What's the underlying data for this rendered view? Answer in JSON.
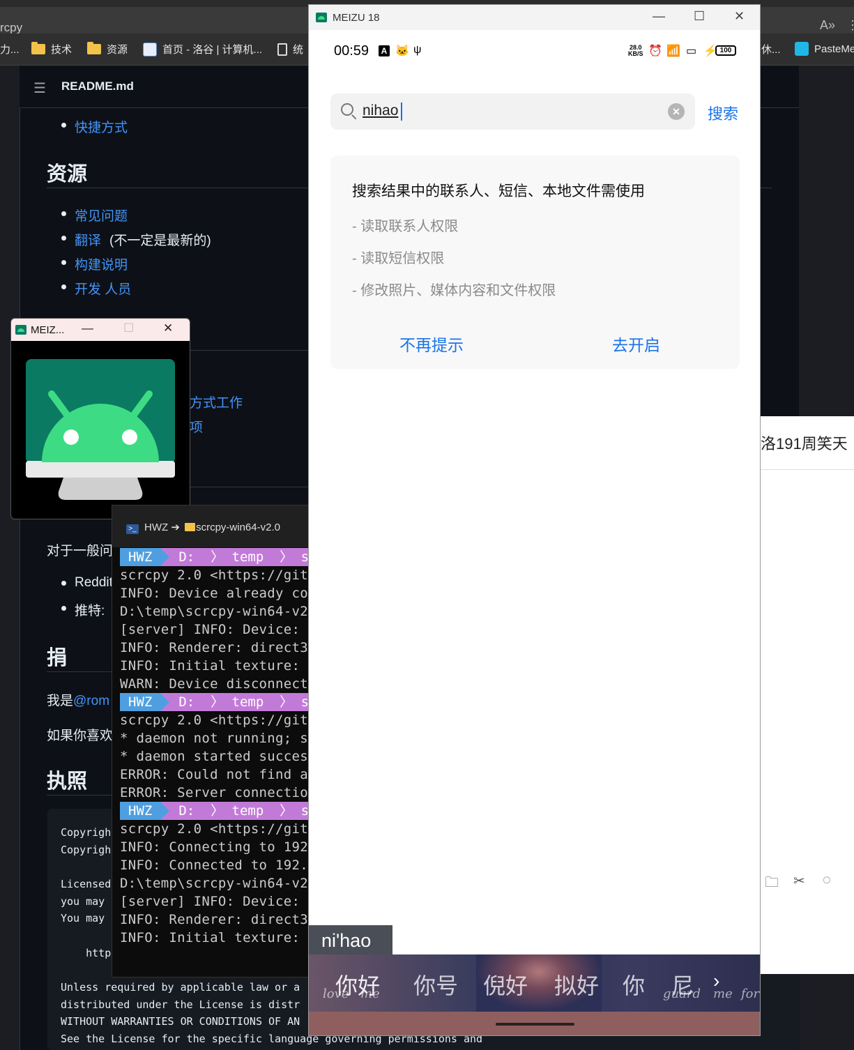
{
  "browser": {
    "title_fragment": "rcpy",
    "bookmarks": [
      {
        "label": "力..."
      },
      {
        "label": "技术"
      },
      {
        "label": "资源"
      },
      {
        "label": "首页 - 洛谷 | 计算机..."
      },
      {
        "label": "统"
      },
      {
        "label": "休..."
      },
      {
        "label": "PasteMe"
      }
    ]
  },
  "readme": {
    "title": "README.md",
    "top_link": "快捷方式",
    "resources_heading": "资源",
    "resource_links": [
      "常见问题",
      "翻译",
      "构建说明",
      "开发 人员"
    ],
    "translation_note": "(不一定是最新的)",
    "partial_link_1": "方式工作",
    "partial_link_2": "项",
    "general_prefix": "对于一般问",
    "bullet_reddit": "Reddit",
    "bullet_twitter": "推特:",
    "donate_heading": "捐",
    "i_am": "我是",
    "author_link": "@rom",
    "if_you_like": "如果你喜欢",
    "license_heading": "执照",
    "code_lines": [
      "Copyrigh",
      "Copyrigh",
      "",
      "Licensed",
      "you may",
      "You may",
      "",
      "    http"
    ],
    "license_tail": [
      "Unless required by applicable law or a",
      "distributed under the License is distr",
      "WITHOUT WARRANTIES OR CONDITIONS OF AN",
      "See the License for the specific language governing permissions and"
    ]
  },
  "right_window": {
    "title": "洛191周笑天"
  },
  "small_window": {
    "title": "MEIZ..."
  },
  "terminal": {
    "tab_label_user": "HWZ",
    "tab_label_arrow": "➔",
    "tab_label_dir": "scrcpy-win64-v2.0",
    "prompt_user": "HWZ",
    "prompt_path": "D:  〉 temp  〉 scr",
    "block1": [
      "scrcpy 2.0 <https://git",
      "INFO: Device already co",
      "D:\\temp\\scrcpy-win64-v2",
      "[server] INFO: Device: ",
      "INFO: Renderer: direct3",
      "INFO: Initial texture: ",
      "WARN: Device disconnect"
    ],
    "block2": [
      "scrcpy 2.0 <https://git",
      "* daemon not running; s",
      "* daemon started succes",
      "ERROR: Could not find a",
      "ERROR: Server connectio"
    ],
    "block3": [
      "scrcpy 2.0 <https://git",
      "INFO: Connecting to 192",
      "INFO: Connected to 192.",
      "D:\\temp\\scrcpy-win64-v2",
      "[server] INFO: Device: ",
      "INFO: Renderer: direct3",
      "INFO: Initial texture: "
    ]
  },
  "phone": {
    "window_title": "MEIZU 18",
    "status": {
      "time": "00:59",
      "net_speed_value": "28.0",
      "net_speed_unit": "KB/S",
      "battery": "100"
    },
    "search": {
      "query": "nihao",
      "action": "搜索"
    },
    "permission_card": {
      "title": "搜索结果中的联系人、短信、本地文件需使用",
      "items": [
        "- 读取联系人权限",
        "- 读取短信权限",
        "- 修改照片、媒体内容和文件权限"
      ],
      "dismiss": "不再提示",
      "enable": "去开启"
    },
    "ime": {
      "composition": "ni'hao",
      "candidates": [
        "你好",
        "你号",
        "倪好",
        "拟好",
        "你",
        "尼"
      ],
      "deco_left": [
        "love",
        "me"
      ],
      "deco_right": [
        "guard",
        "me",
        "for"
      ]
    }
  },
  "colors": {
    "accent_blue": "#1a73e8",
    "github_link": "#4493f8",
    "prompt_user_bg": "#4f9fe0",
    "prompt_path_bg": "#c27ad8",
    "android_green": "#3ddc84"
  }
}
